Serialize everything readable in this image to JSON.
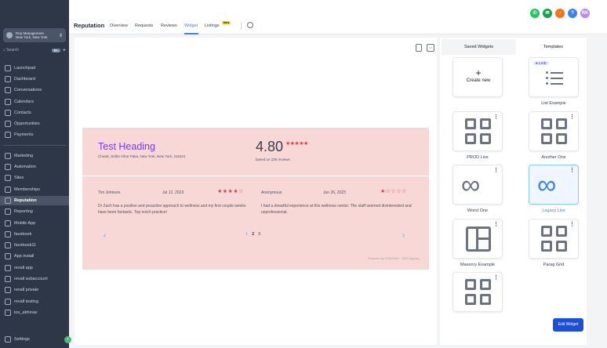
{
  "sidebar": {
    "account_name": "Rep Management",
    "account_location": "New York, New York",
    "search_placeholder": "Search",
    "search_shortcut": "⌘K",
    "items": [
      {
        "label": "Launchpad"
      },
      {
        "label": "Dashboard"
      },
      {
        "label": "Conversations"
      },
      {
        "label": "Calendars"
      },
      {
        "label": "Contacts"
      },
      {
        "label": "Opportunities"
      },
      {
        "label": "Payments"
      },
      {
        "label": "Marketing"
      },
      {
        "label": "Automation"
      },
      {
        "label": "Sites"
      },
      {
        "label": "Memberships"
      },
      {
        "label": "Reputation"
      },
      {
        "label": "Reporting"
      },
      {
        "label": "Mobile App"
      },
      {
        "label": "facebook"
      },
      {
        "label": "facebook11"
      },
      {
        "label": "App install"
      },
      {
        "label": "revall app"
      },
      {
        "label": "revall subaccount"
      },
      {
        "label": "revall private"
      },
      {
        "label": "revall testing"
      },
      {
        "label": "tos_abhinav"
      }
    ],
    "settings_label": "Settings"
  },
  "header": {
    "title": "Reputation",
    "tabs": [
      {
        "label": "Overview"
      },
      {
        "label": "Requests"
      },
      {
        "label": "Reviews"
      },
      {
        "label": "Widget"
      },
      {
        "label": "Listings"
      }
    ],
    "new_badge": "New",
    "avatar_initials": "RK"
  },
  "widget_preview": {
    "heading": "Test Heading",
    "address": "Chowk, Sidha Vihar Patia, New York, New York, 211024",
    "rating": "4.80",
    "rating_stars": "★★★★★",
    "based_on": "based on 225 reviews",
    "reviews": [
      {
        "name": "Tim Johnson",
        "date": "Jul 12, 2023",
        "stars": "★★★★☆",
        "text": "Dr Zach has a positive and proactive approach to wellness and my first couple weeks have been fantastic. Top notch practice!"
      },
      {
        "name": "Anonymous",
        "date": "Jun 26, 2023",
        "stars": "★☆☆☆☆",
        "text": "I had a dreadful experience at this wellness center. The staff seemed disinterested and unprofessional."
      }
    ],
    "pages": [
      "1",
      "2",
      "3"
    ],
    "powered_by": "Powered by STAGING - SEO Agency"
  },
  "right_panel": {
    "tabs": [
      {
        "label": "Saved Widgets"
      },
      {
        "label": "Templates"
      }
    ],
    "create_label": "Create new",
    "live_badge": "LIVE",
    "cards": [
      {
        "label": "List Example"
      },
      {
        "label": "PROD Live"
      },
      {
        "label": "Another One"
      },
      {
        "label": "Worst One"
      },
      {
        "label": "Legacy Live"
      },
      {
        "label": "Masonry Example"
      },
      {
        "label": "Parag Grid"
      }
    ],
    "edit_button": "Edit Widget"
  },
  "colors": {
    "accent": "#3b82f6",
    "widget_bg": "#f8d7d7",
    "heading": "#7c3aed",
    "stars": "#e53e3e",
    "sidebar": "#2d3748"
  }
}
